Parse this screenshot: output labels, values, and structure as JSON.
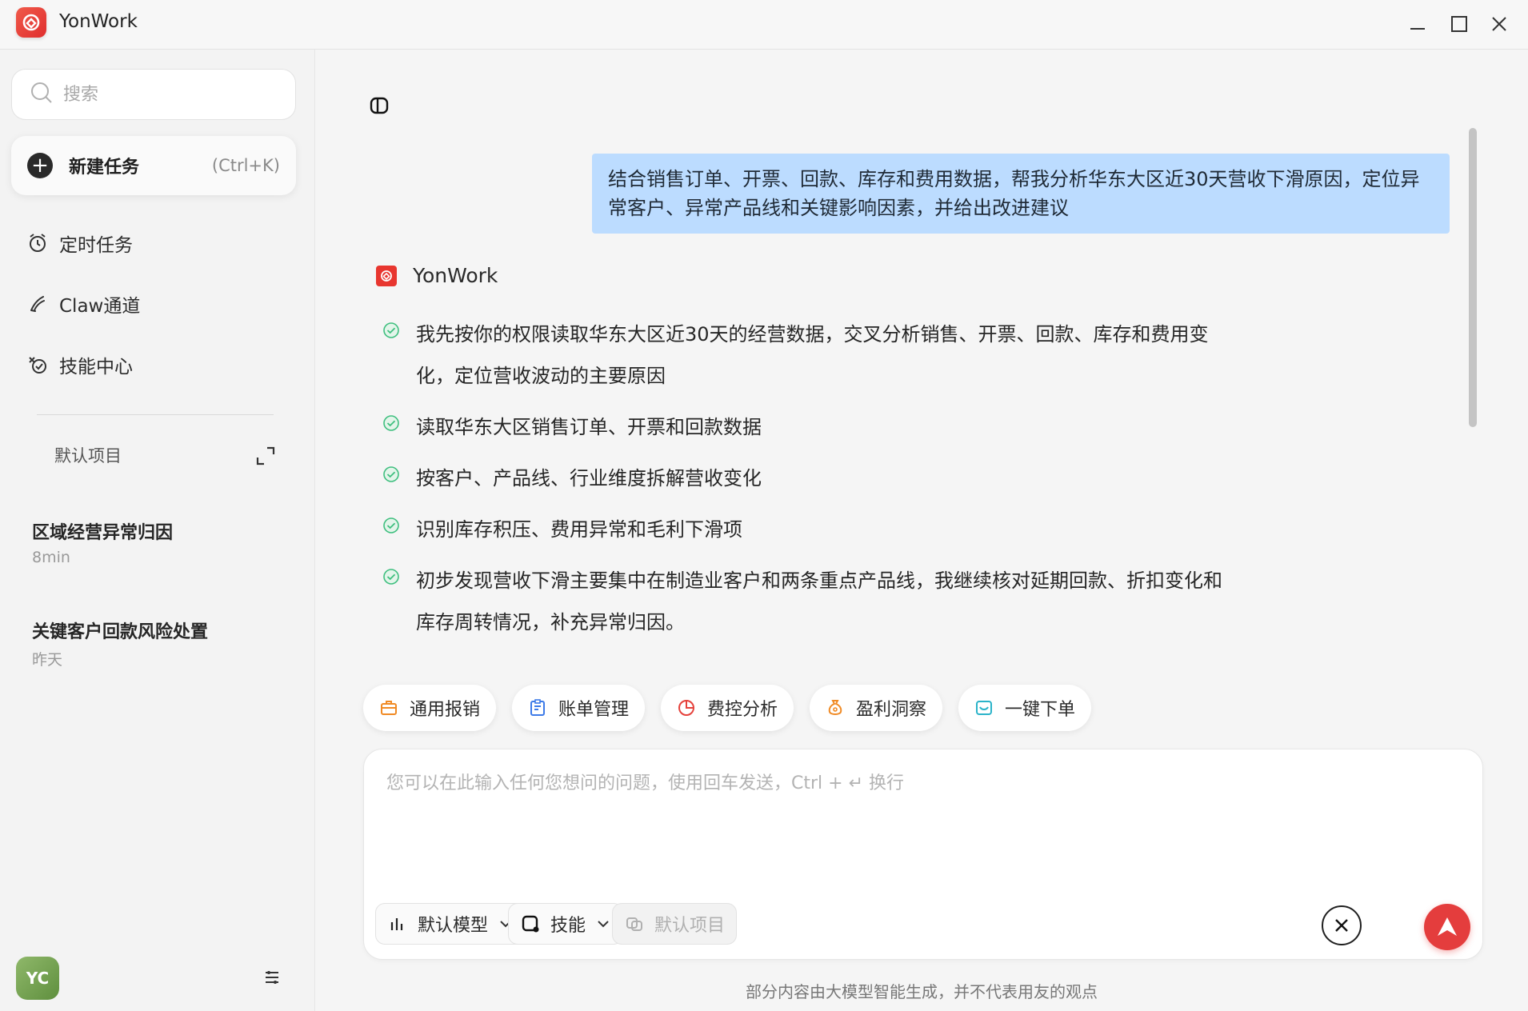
{
  "app": {
    "title": "YonWork"
  },
  "sidebar": {
    "search_placeholder": "搜索",
    "new_task": {
      "label": "新建任务",
      "shortcut": "(Ctrl+K)"
    },
    "nav": [
      {
        "label": "定时任务",
        "icon": "alarm-clock-icon"
      },
      {
        "label": "Claw通道",
        "icon": "claw-icon"
      },
      {
        "label": "技能中心",
        "icon": "skill-icon"
      }
    ],
    "project_label": "默认项目",
    "tasks": [
      {
        "title": "区域经营异常归因",
        "time": "8min"
      },
      {
        "title": "关键客户回款风险处置",
        "time": "昨天"
      }
    ],
    "avatar": "YC"
  },
  "chat": {
    "user_message": "结合销售订单、开票、回款、库存和费用数据，帮我分析华东大区近30天营收下滑原因，定位异常客户、异常产品线和关键影响因素，并给出改进建议",
    "bot_name": "YonWork",
    "steps": [
      "我先按你的权限读取华东大区近30天的经营数据，交叉分析销售、开票、回款、库存和费用变化，定位营收波动的主要原因",
      "读取华东大区销售订单、开票和回款数据",
      "按客户、产品线、行业维度拆解营收变化",
      "识别库存积压、费用异常和毛利下滑项",
      "初步发现营收下滑主要集中在制造业客户和两条重点产品线，我继续核对延期回款、折扣变化和库存周转情况，补充异常归因。"
    ]
  },
  "chips": [
    {
      "label": "通用报销",
      "icon": "briefcase-icon",
      "color": "#f08a24"
    },
    {
      "label": "账单管理",
      "icon": "clipboard-icon",
      "color": "#3d7be8"
    },
    {
      "label": "费控分析",
      "icon": "pie-chart-icon",
      "color": "#e5413b"
    },
    {
      "label": "盈利洞察",
      "icon": "money-bag-icon",
      "color": "#f08a24"
    },
    {
      "label": "一键下单",
      "icon": "order-icon",
      "color": "#2bb3c9"
    }
  ],
  "input": {
    "placeholder": "您可以在此输入任何您想问的问题，使用回车发送，Ctrl + ↵ 换行",
    "model_label": "默认模型",
    "skill_label": "技能",
    "project_label": "默认项目"
  },
  "disclaimer": "部分内容由大模型智能生成，并不代表用友的观点",
  "colors": {
    "accent": "#e43d3d",
    "user_bubble": "#bcdcff",
    "check": "#3fbf7f"
  }
}
